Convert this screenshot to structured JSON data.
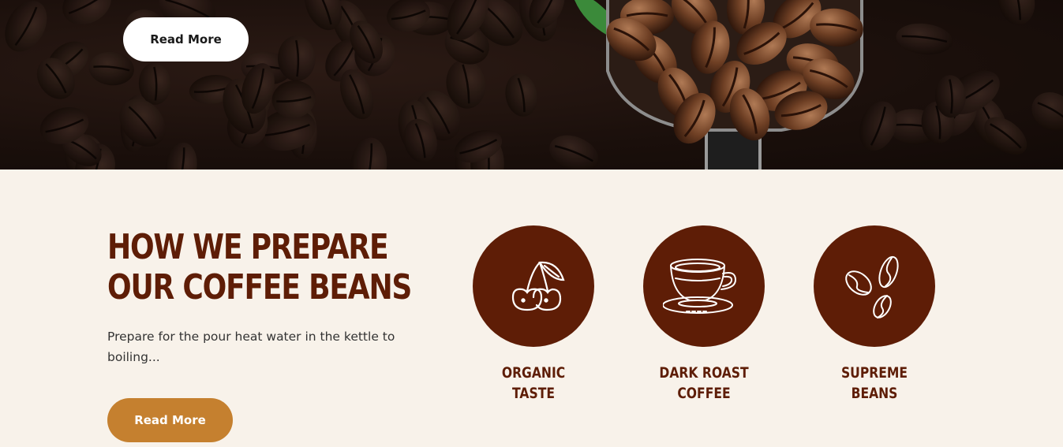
{
  "hero": {
    "read_more_label": "Read More"
  },
  "prepare": {
    "heading_line1": "HOW WE PREPARE",
    "heading_line2": "OUR COFFEE BEANS",
    "description": "Prepare for the pour heat water in the kettle to boiling...",
    "cta_label": "Read More"
  },
  "features": [
    {
      "line1": "ORGANIC",
      "line2": "TASTE",
      "icon": "cherry-icon"
    },
    {
      "line1": "DARK ROAST",
      "line2": "COFFEE",
      "icon": "coffee-cup-icon"
    },
    {
      "line1": "SUPREME",
      "line2": "BEANS",
      "icon": "coffee-beans-icon"
    }
  ],
  "colors": {
    "brand_brown": "#5e1d06",
    "accent_gold": "#c5802f",
    "section_bg": "#f8f2ea"
  }
}
